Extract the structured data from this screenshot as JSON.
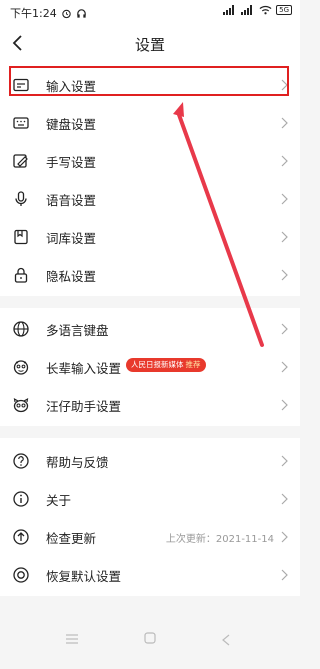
{
  "status": {
    "time": "下午1:24",
    "network": "5G"
  },
  "header": {
    "title": "设置"
  },
  "group1": [
    {
      "label": "输入设置",
      "icon": "input-settings-icon"
    },
    {
      "label": "键盘设置",
      "icon": "keyboard-icon"
    },
    {
      "label": "手写设置",
      "icon": "handwriting-icon"
    },
    {
      "label": "语音设置",
      "icon": "microphone-icon"
    },
    {
      "label": "词库设置",
      "icon": "dictionary-icon"
    },
    {
      "label": "隐私设置",
      "icon": "lock-icon"
    }
  ],
  "group2": [
    {
      "label": "多语言键盘",
      "icon": "globe-icon"
    },
    {
      "label": "长辈输入设置",
      "icon": "elder-face-icon",
      "badge": "人民日报新媒体",
      "badge_tag": "推荐"
    },
    {
      "label": "汪仔助手设置",
      "icon": "dog-assistant-icon"
    }
  ],
  "group3": [
    {
      "label": "帮助与反馈",
      "icon": "help-icon"
    },
    {
      "label": "关于",
      "icon": "info-icon"
    },
    {
      "label": "检查更新",
      "icon": "update-icon",
      "meta": "上次更新：2021-11-14"
    },
    {
      "label": "恢复默认设置",
      "icon": "restore-icon"
    }
  ],
  "colors": {
    "highlight": "#e02020",
    "arrow": "#e8394a",
    "badge": "#e8392c"
  }
}
